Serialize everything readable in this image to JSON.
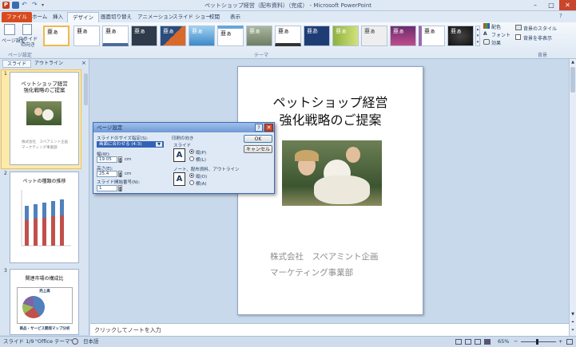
{
  "window": {
    "title": "ペットショップ経営（配布資料）（完成） - Microsoft PowerPoint",
    "app_icon": "P"
  },
  "tabs": [
    "ファイル",
    "ホーム",
    "挿入",
    "デザイン",
    "画面切り替え",
    "アニメーション",
    "スライド ショー",
    "校閲",
    "表示"
  ],
  "ribbon": {
    "page_setup": {
      "btn1": "ページ設定",
      "btn2": "スライドの向き",
      "group": "ページ設定"
    },
    "themes_group": "テーマ",
    "theme_sample": "亜ぁ",
    "theme_sample2": "亜あ",
    "colors": "配色",
    "fonts": "フォント",
    "effects": "効果",
    "bg_style": "背景のスタイル",
    "hide_bg": "背景を非表示",
    "bg_group": "背景"
  },
  "panel": {
    "tab_slides": "スライド",
    "tab_outline": "アウトライン"
  },
  "thumbs": {
    "s1": {
      "num": "1",
      "title": "ペットショップ経営\n強化戦略のご提案",
      "company": "株式会社　スペアミント企画\nマーケティング事業部"
    },
    "s2": {
      "num": "2",
      "title": "ペットの種類の推移"
    },
    "s3": {
      "num": "3",
      "title": "関連市場の構成比",
      "chart_title": "売上高",
      "footer": "商品・サービス開発マップ分析"
    }
  },
  "slide": {
    "title_line1": "ペットショップ経営",
    "title_line2": "強化戦略のご提案",
    "company": "株式会社　スペアミント企画",
    "dept": "マーケティング事業部"
  },
  "notes": "クリックしてノートを入力",
  "status": {
    "slide": "スライド 1/9",
    "theme": "\"Office テーマ\"",
    "lang": "日本語",
    "zoom": "65%"
  },
  "dialog": {
    "title": "ページ設定",
    "size_label": "スライドのサイズ指定(S):",
    "size_value": "画面に合わせる (4:3)",
    "width_label": "幅(W):",
    "width_value": "19.05",
    "height_label": "高さ(E):",
    "height_value": "25.4",
    "unit": "cm",
    "start_label": "スライド開始番号(N):",
    "start_value": "1",
    "orient_label": "印刷の向き",
    "slide_label": "スライド",
    "portrait": "縦(P)",
    "landscape": "横(L)",
    "notes_label": "ノート、配布資料、アウトライン",
    "portrait2": "縦(O)",
    "landscape2": "横(A)",
    "ok": "OK",
    "cancel": "キャンセル"
  }
}
